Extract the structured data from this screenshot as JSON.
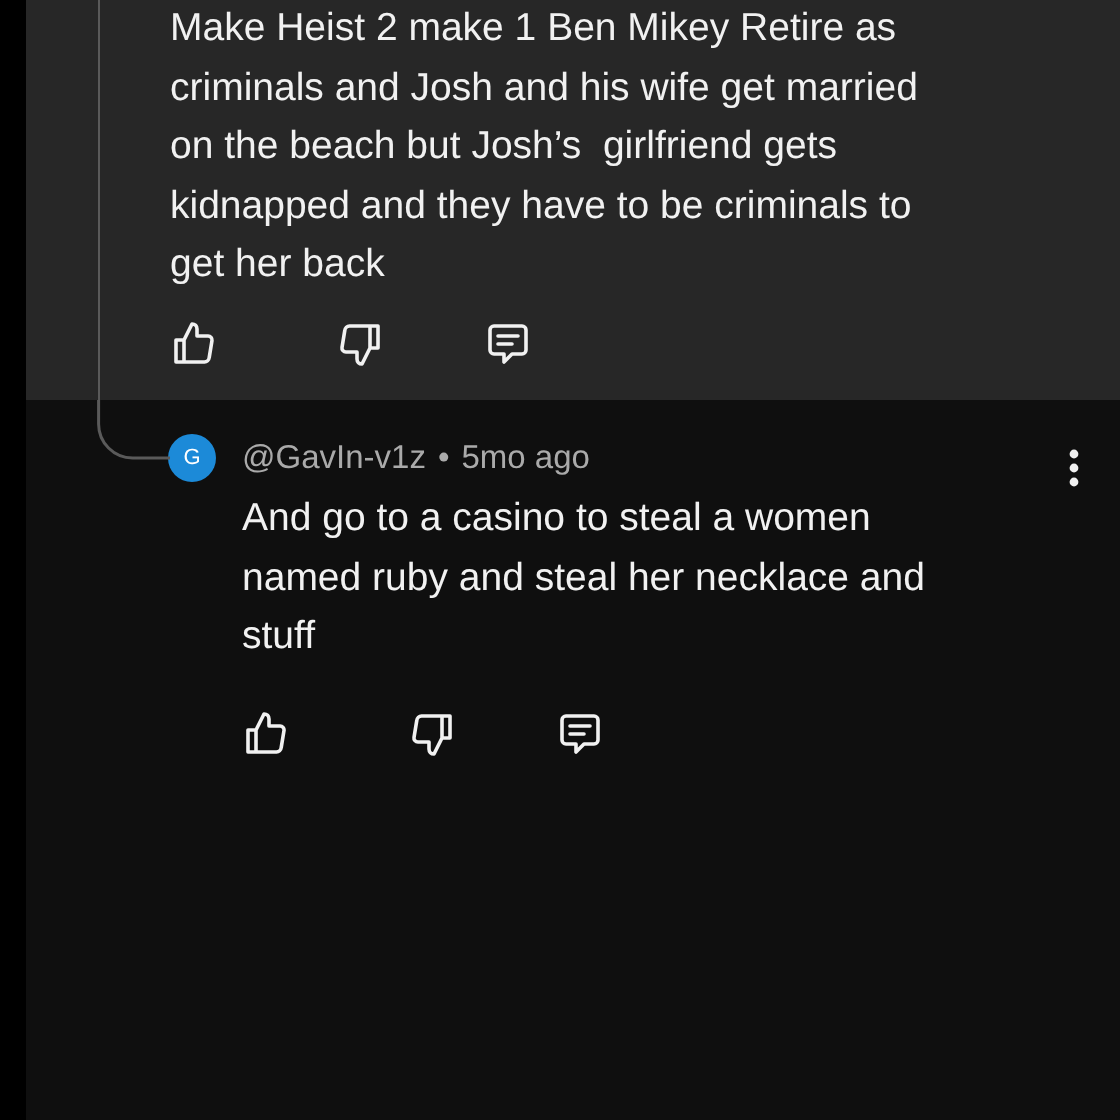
{
  "comments": [
    {
      "text": "Make Heist 2 make 1 Ben Mikey Retire as\ncriminals and Josh and his wife get married\non the beach but Josh’s  girlfriend gets\nkidnapped and they have to be criminals to\nget her back"
    },
    {
      "avatar": "G",
      "author": "@GavIn-v1z",
      "separator": "•",
      "time": "5mo ago",
      "text": "And go to a casino to steal a women\nnamed ruby and steal her necklace and\nstuff"
    }
  ]
}
